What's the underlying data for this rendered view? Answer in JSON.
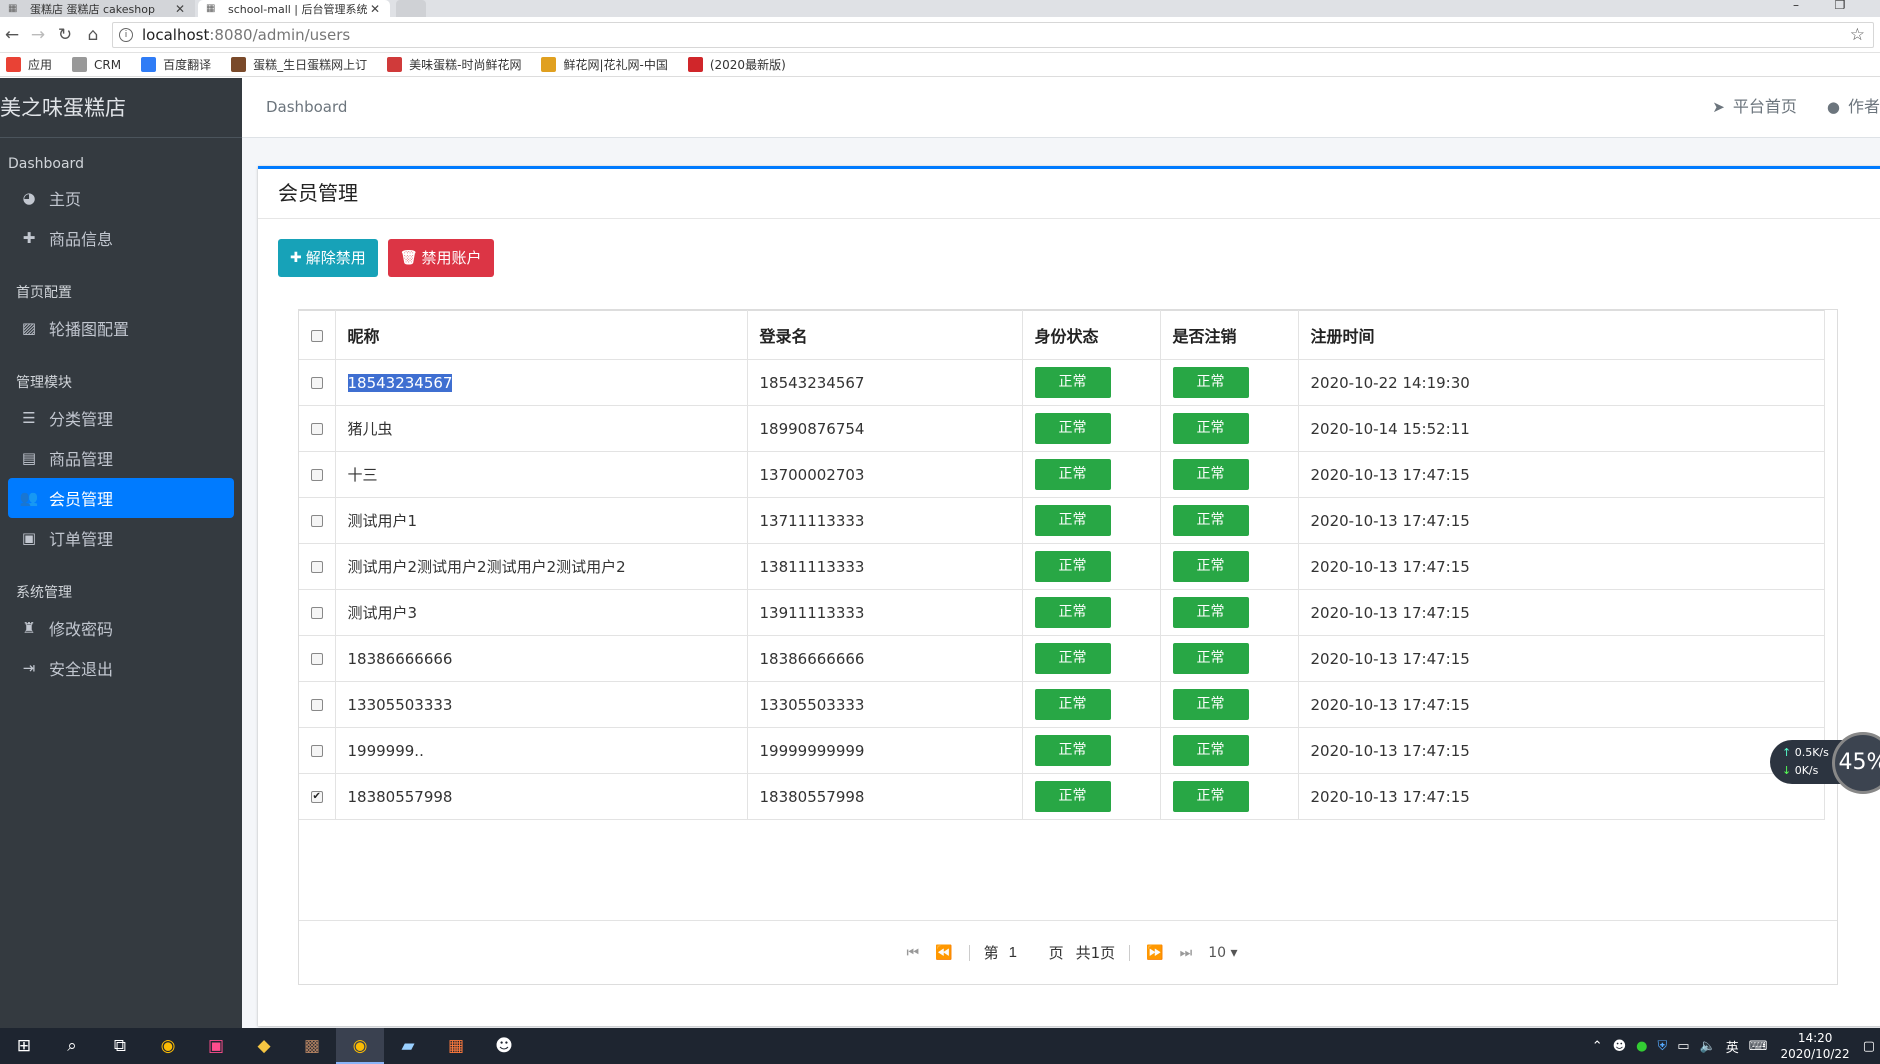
{
  "browser": {
    "tabs": [
      {
        "label": "蛋糕店 蛋糕店 cakeshop"
      },
      {
        "label": "school-mall | 后台管理系统"
      }
    ],
    "url_host": "localhost",
    "url_path": ":8080/admin/users",
    "bookmarks": [
      {
        "label": "应用",
        "icon": "apps-icon",
        "color": "#e94235"
      },
      {
        "label": "CRM",
        "icon": "page-icon",
        "color": "#999999"
      },
      {
        "label": "百度翻译",
        "icon": "translate-icon",
        "color": "#2f7cf6"
      },
      {
        "label": "蛋糕_生日蛋糕网上订",
        "icon": "cake-icon",
        "color": "#7a4a2a"
      },
      {
        "label": "美味蛋糕-时尚鲜花网",
        "icon": "flower-icon",
        "color": "#d03a3a"
      },
      {
        "label": "鲜花网|花礼网-中国",
        "icon": "flower2-icon",
        "color": "#e0a020"
      },
      {
        "label": "(2020最新版)",
        "icon": "c-icon",
        "color": "#d0262a"
      }
    ]
  },
  "sidebar": {
    "brand": "美之味蛋糕店",
    "sections": [
      {
        "header": "Dashboard",
        "items": [
          {
            "label": "主页",
            "icon": "dashboard-icon",
            "glyph": "◕"
          },
          {
            "label": "商品信息",
            "icon": "plus-icon",
            "glyph": "✚"
          }
        ]
      },
      {
        "header": "首页配置",
        "items": [
          {
            "label": "轮播图配置",
            "icon": "image-icon",
            "glyph": "▨"
          }
        ]
      },
      {
        "header": "管理模块",
        "items": [
          {
            "label": "分类管理",
            "icon": "list-icon",
            "glyph": "☰"
          },
          {
            "label": "商品管理",
            "icon": "archive-icon",
            "glyph": "▤"
          },
          {
            "label": "会员管理",
            "icon": "users-icon",
            "glyph": "👥",
            "active": true
          },
          {
            "label": "订单管理",
            "icon": "money-icon",
            "glyph": "▣"
          }
        ]
      },
      {
        "header": "系统管理",
        "items": [
          {
            "label": "修改密码",
            "icon": "user-secret-icon",
            "glyph": "♜"
          },
          {
            "label": "安全退出",
            "icon": "sign-out-icon",
            "glyph": "⇥"
          }
        ]
      }
    ]
  },
  "topnav": {
    "breadcrumb": "Dashboard",
    "links": [
      {
        "label": "平台首页",
        "icon": "paper-plane-icon",
        "glyph": "➤"
      },
      {
        "label": "作者",
        "icon": "user-icon",
        "glyph": "●"
      }
    ]
  },
  "card": {
    "title": "会员管理",
    "buttons": [
      {
        "label": "解除禁用",
        "icon": "plus-icon",
        "glyph": "✚",
        "style": "info"
      },
      {
        "label": "禁用账户",
        "icon": "trash-icon",
        "glyph": "🗑",
        "style": "danger"
      }
    ]
  },
  "table": {
    "headers": [
      "昵称",
      "登录名",
      "身份状态",
      "是否注销",
      "注册时间"
    ],
    "rows": [
      {
        "nickname": "18543234567",
        "login": "18543234567",
        "status": "正常",
        "deleted": "正常",
        "time": "2020-10-22 14:19:30",
        "checked": false,
        "highlight": true
      },
      {
        "nickname": "猪儿虫",
        "login": "18990876754",
        "status": "正常",
        "deleted": "正常",
        "time": "2020-10-14 15:52:11",
        "checked": false
      },
      {
        "nickname": "十三",
        "login": "13700002703",
        "status": "正常",
        "deleted": "正常",
        "time": "2020-10-13 17:47:15",
        "checked": false
      },
      {
        "nickname": "测试用户1",
        "login": "13711113333",
        "status": "正常",
        "deleted": "正常",
        "time": "2020-10-13 17:47:15",
        "checked": false
      },
      {
        "nickname": "测试用户2测试用户2测试用户2测试用户2",
        "login": "13811113333",
        "status": "正常",
        "deleted": "正常",
        "time": "2020-10-13 17:47:15",
        "checked": false
      },
      {
        "nickname": "测试用户3",
        "login": "13911113333",
        "status": "正常",
        "deleted": "正常",
        "time": "2020-10-13 17:47:15",
        "checked": false
      },
      {
        "nickname": "18386666666",
        "login": "18386666666",
        "status": "正常",
        "deleted": "正常",
        "time": "2020-10-13 17:47:15",
        "checked": false
      },
      {
        "nickname": "13305503333",
        "login": "13305503333",
        "status": "正常",
        "deleted": "正常",
        "time": "2020-10-13 17:47:15",
        "checked": false
      },
      {
        "nickname": "1999999..",
        "login": "19999999999",
        "status": "正常",
        "deleted": "正常",
        "time": "2020-10-13 17:47:15",
        "checked": false
      },
      {
        "nickname": "18380557998",
        "login": "18380557998",
        "status": "正常",
        "deleted": "正常",
        "time": "2020-10-13 17:47:15",
        "checked": true
      }
    ]
  },
  "pager": {
    "page_prefix": "第",
    "page_value": "1",
    "page_suffix": "页",
    "total": "共1页",
    "page_size": "10 ▾"
  },
  "speed_widget": {
    "up": "0.5K/s",
    "down": "0K/s",
    "percent": "45%"
  },
  "taskbar": {
    "time": "14:20",
    "date": "2020/10/22",
    "ime": "英"
  }
}
